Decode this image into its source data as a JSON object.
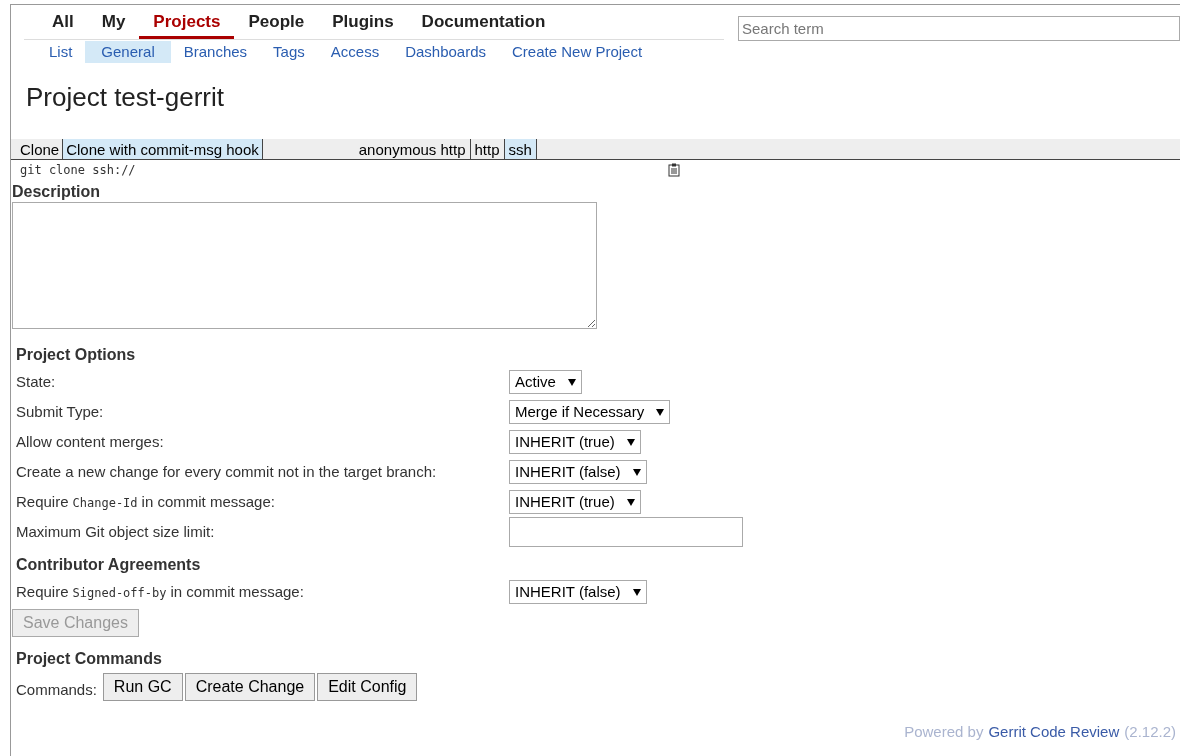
{
  "top_menu": [
    {
      "label": "All",
      "selected": false
    },
    {
      "label": "My",
      "selected": false
    },
    {
      "label": "Projects",
      "selected": true
    },
    {
      "label": "People",
      "selected": false
    },
    {
      "label": "Plugins",
      "selected": false
    },
    {
      "label": "Documentation",
      "selected": false
    }
  ],
  "search": {
    "placeholder": "Search term"
  },
  "sub_menu": [
    {
      "label": "List",
      "selected": false
    },
    {
      "label": "General",
      "selected": true
    },
    {
      "label": "Branches",
      "selected": false
    },
    {
      "label": "Tags",
      "selected": false
    },
    {
      "label": "Access",
      "selected": false
    },
    {
      "label": "Dashboards",
      "selected": false
    },
    {
      "label": "Create New Project",
      "selected": false
    }
  ],
  "page_title": "Project test-gerrit",
  "clone_commands": [
    {
      "label": "Clone",
      "selected": false
    },
    {
      "label": "Clone with commit-msg hook",
      "selected": true
    }
  ],
  "clone_schemes": [
    {
      "label": "anonymous http",
      "selected": false
    },
    {
      "label": "http",
      "selected": false
    },
    {
      "label": "ssh",
      "selected": true
    }
  ],
  "clone_url": "git clone ssh://",
  "description": {
    "heading": "Description"
  },
  "project_options": {
    "heading": "Project Options",
    "rows": [
      {
        "kind": "select",
        "label": [
          {
            "text": "State:",
            "code": false
          }
        ],
        "value": "Active"
      },
      {
        "kind": "select",
        "label": [
          {
            "text": "Submit Type:",
            "code": false
          }
        ],
        "value": "Merge if Necessary"
      },
      {
        "kind": "select",
        "label": [
          {
            "text": "Allow content merges:",
            "code": false
          }
        ],
        "value": "INHERIT (true)"
      },
      {
        "kind": "select",
        "label": [
          {
            "text": "Create a new change for every commit not in the target branch:",
            "code": false
          }
        ],
        "value": "INHERIT (false)"
      },
      {
        "kind": "select",
        "label": [
          {
            "text": "Require",
            "code": false
          },
          {
            "text": "Change-Id",
            "code": true
          },
          {
            "text": "in commit message:",
            "code": false
          }
        ],
        "value": "INHERIT (true)"
      },
      {
        "kind": "input",
        "label": [
          {
            "text": "Maximum Git object size limit:",
            "code": false
          }
        ]
      }
    ]
  },
  "contributor_agreements": {
    "heading": "Contributor Agreements",
    "rows": [
      {
        "kind": "select",
        "label": [
          {
            "text": "Require",
            "code": false
          },
          {
            "text": "Signed-off-by",
            "code": true
          },
          {
            "text": "in commit message:",
            "code": false
          }
        ],
        "value": "INHERIT (false)"
      }
    ]
  },
  "save_button": {
    "label": "Save Changes",
    "disabled": true
  },
  "project_commands": {
    "heading": "Project Commands",
    "label": "Commands:",
    "buttons": [
      "Run GC",
      "Create Change",
      "Edit Config"
    ]
  },
  "footer": {
    "prefix": "Powered by",
    "link": "Gerrit Code Review",
    "version": "(2.12.2)"
  }
}
